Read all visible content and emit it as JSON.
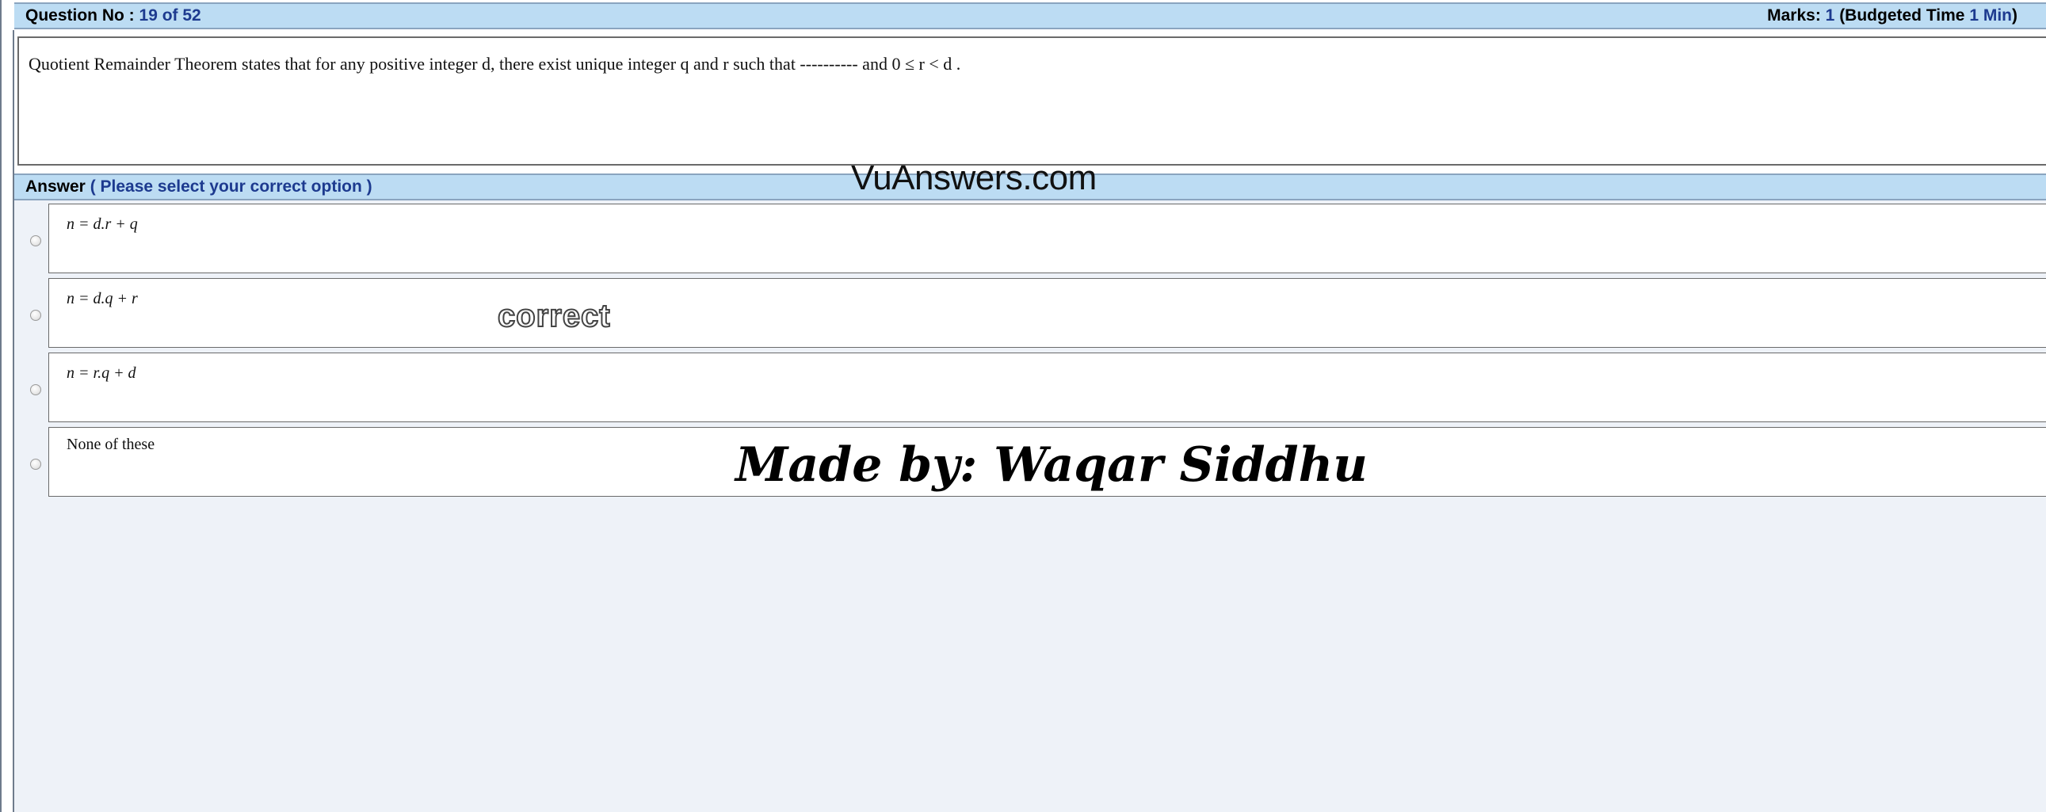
{
  "header": {
    "question_label": "Question No :",
    "question_number": "19 of 52",
    "marks_label": "Marks:",
    "marks_value": "1",
    "budget_open": "(Budgeted Time",
    "budget_value": "1 Min",
    "budget_close": ")"
  },
  "question": {
    "text": "Quotient Remainder Theorem states that for any positive integer d, there exist unique integer q and r such that ---------- and 0 ≤ r < d ."
  },
  "answer_bar": {
    "label": "Answer",
    "instruction": "( Please select your correct option )"
  },
  "options": [
    {
      "label": "n = d.r + q"
    },
    {
      "label": "n = d.q + r"
    },
    {
      "label": "n = r.q + d"
    },
    {
      "label": "None of these"
    }
  ],
  "watermarks": {
    "site": "VuAnswers.com",
    "correct": "correct",
    "author": "Made by: Waqar Siddhu"
  },
  "colors": {
    "bar_background": "#bcdcf3",
    "accent_text": "#1d3a8f"
  }
}
